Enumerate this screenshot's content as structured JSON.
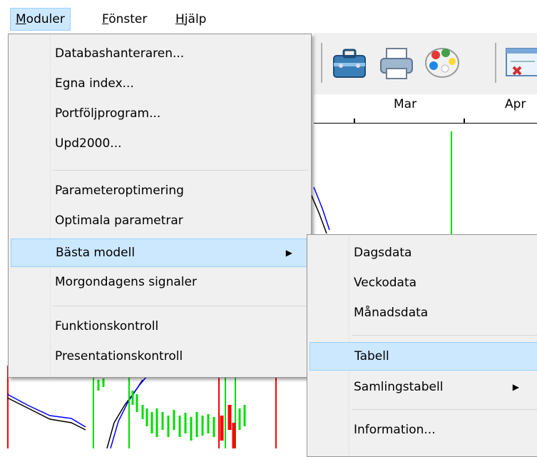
{
  "menubar": {
    "items": [
      {
        "label": "Moduler",
        "active": true
      },
      {
        "label": "Fönster",
        "active": false
      },
      {
        "label": "Hjälp",
        "active": false
      }
    ]
  },
  "toolbar": {
    "icons": [
      "toolbox-icon",
      "printer-icon",
      "palette-icon",
      "chart-delete-icon"
    ]
  },
  "chart": {
    "axis_labels": [
      "Mar",
      "Apr"
    ],
    "colors": {
      "bull": "#00dd00",
      "bear": "#ff0000",
      "line1": "#0000ff",
      "line2": "#000000"
    }
  },
  "moduler_menu": {
    "groups": [
      [
        "Databashanteraren...",
        "Egna index...",
        "Portföljprogram...",
        "Upd2000..."
      ],
      [
        "Parameteroptimering",
        "Optimala parametrar",
        "Bästa modell",
        "Morgondagens signaler"
      ],
      [
        "Funktionskontroll",
        "Presentationskontroll"
      ]
    ],
    "highlighted": "Bästa modell"
  },
  "basta_modell_submenu": {
    "groups": [
      [
        "Dagsdata",
        "Veckodata",
        "Månadsdata"
      ],
      [
        "Tabell",
        "Samlingstabell"
      ],
      [
        "Information..."
      ]
    ],
    "highlighted": "Tabell"
  },
  "colors": {
    "highlight": "#cce8ff",
    "highlight_border": "#99d1ff",
    "menu_bg": "#f0f0f0"
  }
}
